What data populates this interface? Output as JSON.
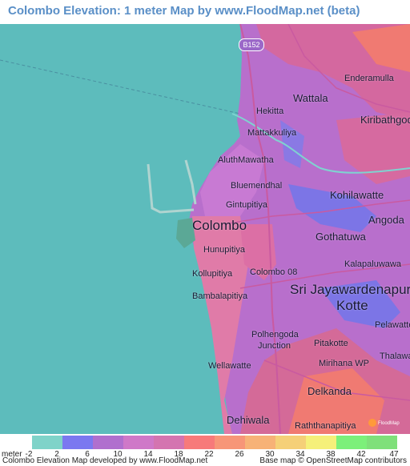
{
  "title": "Colombo Elevation: 1 meter Map by www.FloodMap.net (beta)",
  "road_shield": "B152",
  "places": [
    {
      "name": "Enderamulla",
      "size": "small"
    },
    {
      "name": "Wattala",
      "size": "med"
    },
    {
      "name": "Hekitta",
      "size": "small"
    },
    {
      "name": "Kiribathgoda",
      "size": "med"
    },
    {
      "name": "Mattakkuliya",
      "size": "small"
    },
    {
      "name": "AluthMawatha",
      "size": "small"
    },
    {
      "name": "Bluemendhal",
      "size": "small"
    },
    {
      "name": "Kohilawatte",
      "size": "med"
    },
    {
      "name": "Gintupitiya",
      "size": "small"
    },
    {
      "name": "Angoda",
      "size": "med"
    },
    {
      "name": "Colombo",
      "size": "big"
    },
    {
      "name": "Gothatuwa",
      "size": "med"
    },
    {
      "name": "Hunupitiya",
      "size": "small"
    },
    {
      "name": "Kalapaluwawa",
      "size": "small"
    },
    {
      "name": "Kollupitiya",
      "size": "small"
    },
    {
      "name": "Colombo 08",
      "size": "small"
    },
    {
      "name": "Sri Jayawardenapura",
      "size": "big"
    },
    {
      "name": "Kotte",
      "size": "big"
    },
    {
      "name": "Bambalapitiya",
      "size": "small"
    },
    {
      "name": "Pelawatte",
      "size": "small"
    },
    {
      "name": "Polhengoda",
      "size": "small"
    },
    {
      "name": "Junction",
      "size": "small"
    },
    {
      "name": "Pitakotte",
      "size": "small"
    },
    {
      "name": "Thalawat",
      "size": "small"
    },
    {
      "name": "Mirihana WP",
      "size": "small"
    },
    {
      "name": "Wellawatte",
      "size": "small"
    },
    {
      "name": "Delkanda",
      "size": "med"
    },
    {
      "name": "Dehiwala",
      "size": "med"
    },
    {
      "name": "Raththanapitiya",
      "size": "small"
    }
  ],
  "legend": {
    "unit_label": "meter",
    "ticks": [
      "-2",
      "2",
      "6",
      "10",
      "14",
      "18",
      "22",
      "26",
      "30",
      "34",
      "38",
      "42",
      "47"
    ],
    "colors": [
      "#7fd3c9",
      "#7b78f0",
      "#b06fce",
      "#cf78c8",
      "#d474b0",
      "#f77a7a",
      "#f79678",
      "#f7b277",
      "#f5d078",
      "#f5f07a",
      "#7cf07a",
      "#7fe07a"
    ]
  },
  "credits": {
    "left": "Colombo Elevation Map developed by www.FloodMap.net",
    "right": "Base map © OpenStreetMap contributors"
  },
  "watermark": "FloodMap"
}
